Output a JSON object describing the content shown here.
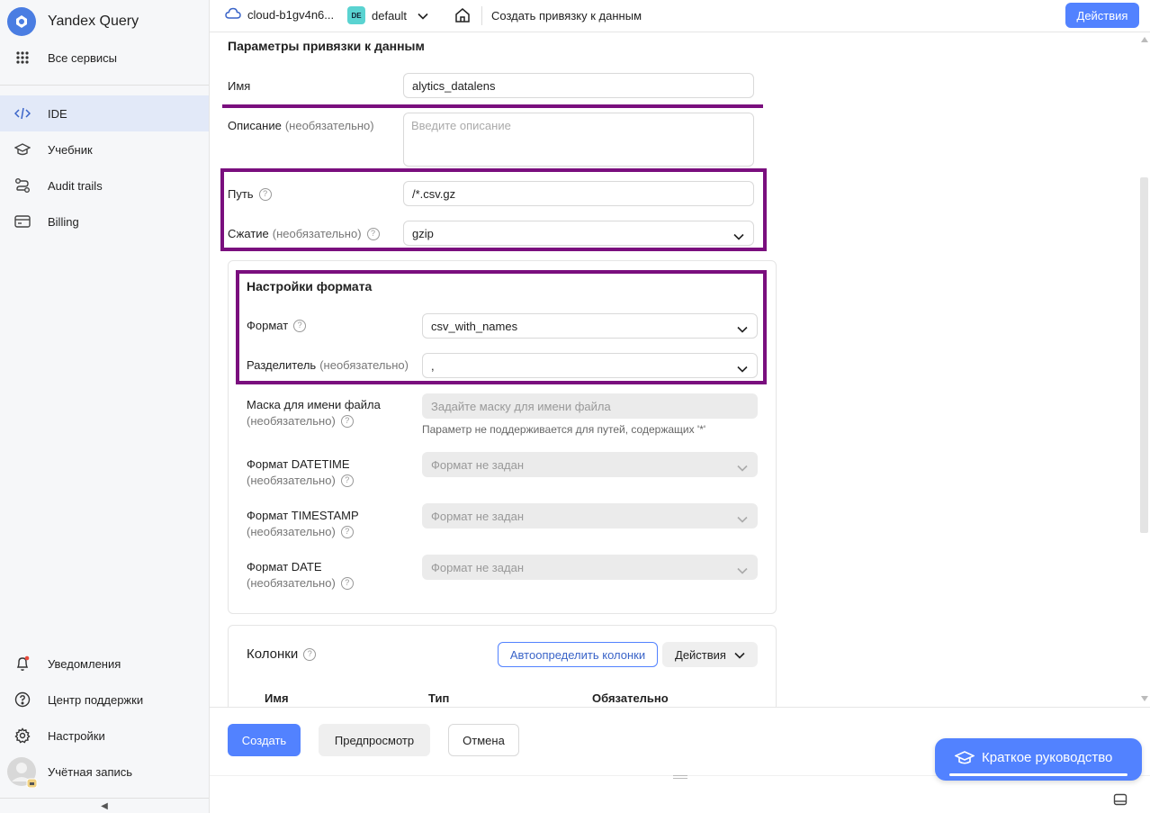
{
  "sidebar": {
    "brand": "Yandex Query",
    "all_services": "Все сервисы",
    "items": [
      {
        "label": "IDE",
        "icon": "code-icon"
      },
      {
        "label": "Учебник",
        "icon": "graduation-cap-icon"
      },
      {
        "label": "Audit trails",
        "icon": "route-icon"
      },
      {
        "label": "Billing",
        "icon": "credit-card-icon"
      }
    ],
    "bottom": [
      {
        "label": "Уведомления",
        "icon": "bell-icon"
      },
      {
        "label": "Центр поддержки",
        "icon": "question-circle-icon"
      },
      {
        "label": "Настройки",
        "icon": "gear-icon"
      },
      {
        "label": "Учётная запись",
        "icon": "avatar"
      }
    ],
    "collapse_glyph": "◀"
  },
  "header": {
    "cloud": "cloud-b1gv4n6...",
    "folder_badge": "DE",
    "folder": "default",
    "crumb": "Создать привязку к данным",
    "actions": "Действия"
  },
  "form": {
    "section_title": "Параметры привязки к данным",
    "name": {
      "label": "Имя",
      "value": "alytics_datalens"
    },
    "description": {
      "label": "Описание",
      "optional": "(необязательно)",
      "placeholder": "Введите описание"
    },
    "path": {
      "label": "Путь",
      "value": "/*.csv.gz"
    },
    "compression": {
      "label": "Сжатие",
      "optional": "(необязательно)",
      "value": "gzip"
    },
    "format_settings": {
      "title": "Настройки формата",
      "format": {
        "label": "Формат",
        "value": "csv_with_names"
      },
      "delimiter": {
        "label": "Разделитель",
        "optional": "(необязательно)",
        "value": ","
      },
      "file_mask": {
        "label": "Маска для имени файла",
        "optional": "(необязательно)",
        "placeholder": "Задайте маску для имени файла",
        "hint": "Параметр не поддерживается для путей, содержащих '*'"
      },
      "datetime": {
        "label": "Формат DATETIME",
        "optional": "(необязательно)",
        "value": "Формат не задан"
      },
      "timestamp": {
        "label": "Формат TIMESTAMP",
        "optional": "(необязательно)",
        "value": "Формат не задан"
      },
      "date": {
        "label": "Формат DATE",
        "optional": "(необязательно)",
        "value": "Формат не задан"
      }
    },
    "columns": {
      "title": "Колонки",
      "auto_detect": "Автоопределить колонки",
      "actions": "Действия",
      "headers": [
        "Имя",
        "Тип",
        "Обязательно"
      ]
    }
  },
  "footer": {
    "create": "Создать",
    "preview": "Предпросмотр",
    "cancel": "Отмена",
    "guide": "Краткое руководство"
  },
  "help_glyph": "?",
  "colors": {
    "accent": "#5282ff",
    "highlight": "#7a0f7e",
    "sidebar_active": "#e2e9f8"
  }
}
